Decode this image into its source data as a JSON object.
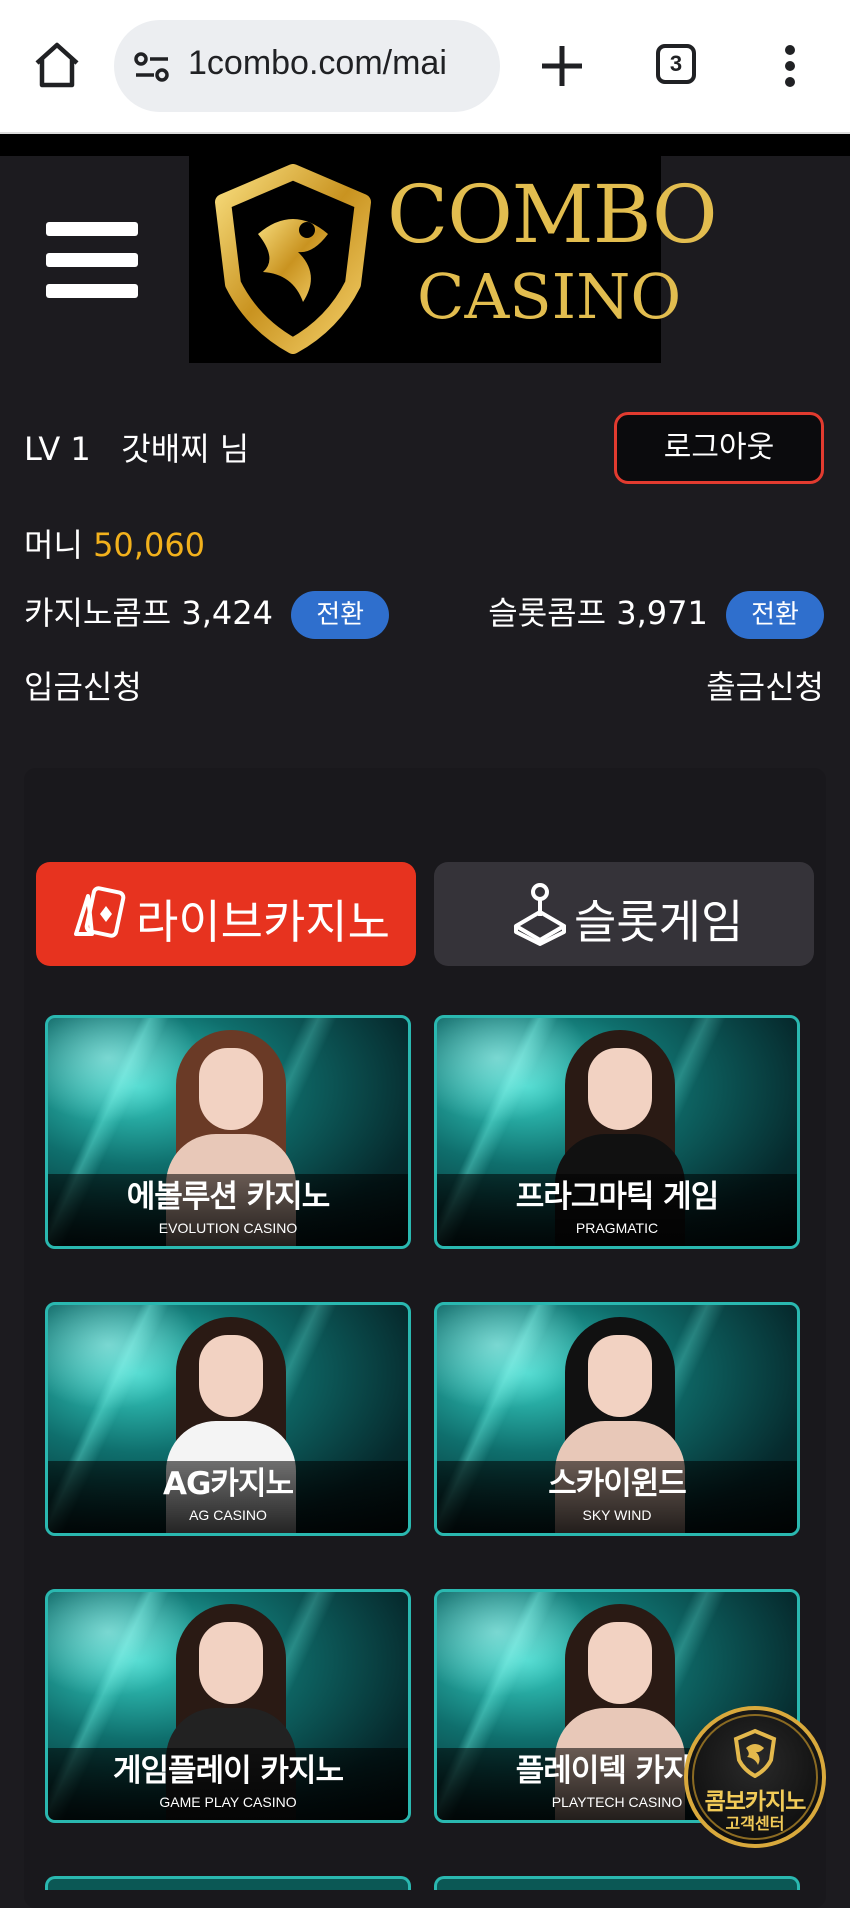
{
  "browser": {
    "url": "1combo.com/mai",
    "tab_count": "3"
  },
  "logo": {
    "line1": "COMBO",
    "line2": "CASINO"
  },
  "user": {
    "level": "LV 1",
    "name": "갓배찌 님",
    "logout_label": "로그아웃",
    "money_label": "머니",
    "money_value": "50,060",
    "casino_comp_label": "카지노콤프 3,424",
    "slot_comp_label": "슬롯콤프 3,971",
    "convert_label": "전환",
    "deposit_label": "입금신청",
    "withdraw_label": "출금신청"
  },
  "tabs": {
    "live": "라이브카지노",
    "slot": "슬롯게임"
  },
  "games": [
    {
      "title": "에볼루션 카지노",
      "subtitle": "EVOLUTION CASINO"
    },
    {
      "title": "프라그마틱 게임",
      "subtitle": "PRAGMATIC"
    },
    {
      "title": "AG카지노",
      "subtitle": "AG CASINO"
    },
    {
      "title": "스카이윈드",
      "subtitle": "SKY WIND"
    },
    {
      "title": "게임플레이 카지노",
      "subtitle": "GAME PLAY CASINO"
    },
    {
      "title": "플레이텍 카지노",
      "subtitle": "PLAYTECH CASINO"
    }
  ],
  "support": {
    "line1": "콤보카지노",
    "line2": "고객센터"
  },
  "colors": {
    "accent_red": "#e7331f",
    "money_gold": "#f2b11c",
    "convert_blue": "#2f6fcd",
    "card_border": "#2ab8b0"
  }
}
